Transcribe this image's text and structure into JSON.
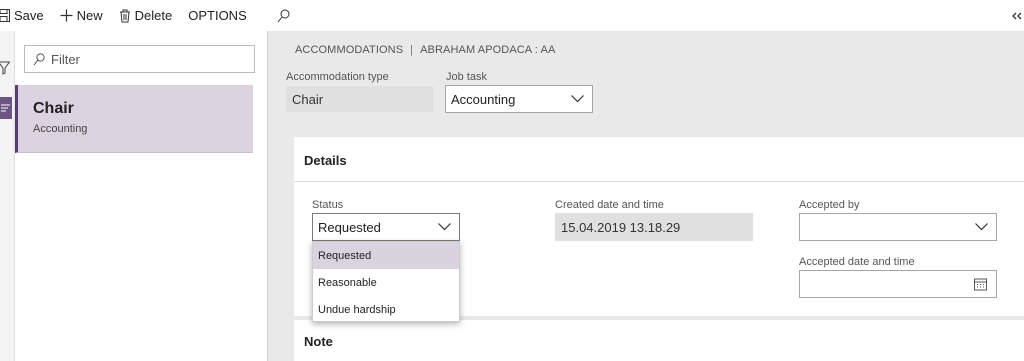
{
  "toolbar": {
    "save": "Save",
    "new": "New",
    "delete": "Delete",
    "options": "OPTIONS"
  },
  "list": {
    "filter_placeholder": "Filter",
    "items": [
      {
        "title": "Chair",
        "subtitle": "Accounting",
        "selected": true
      }
    ]
  },
  "breadcrumb": {
    "section": "ACCOMMODATIONS",
    "separator": "|",
    "record": "ABRAHAM APODACA : AA"
  },
  "header_fields": {
    "accommodation_type_label": "Accommodation type",
    "accommodation_type_value": "Chair",
    "job_task_label": "Job task",
    "job_task_value": "Accounting"
  },
  "details": {
    "title": "Details",
    "status_label": "Status",
    "status_value": "Requested",
    "created_label": "Created date and time",
    "created_value": "15.04.2019 13.18.29",
    "accepted_by_label": "Accepted by",
    "accepted_by_value": "",
    "accepted_date_label": "Accepted date and time",
    "accepted_date_value": ""
  },
  "status_dropdown": {
    "options": [
      "Requested",
      "Reasonable",
      "Undue hardship"
    ],
    "highlighted": "Requested"
  },
  "note": {
    "title": "Note"
  },
  "colors": {
    "accent": "#5a3d70",
    "selected_bg": "#dcd3e0",
    "page_bg": "#e9e9e9"
  },
  "icons": [
    "save-icon",
    "plus-icon",
    "trash-icon",
    "search-icon",
    "filter-icon",
    "list-icon",
    "chevron-down-icon",
    "calendar-icon",
    "more-icon"
  ]
}
